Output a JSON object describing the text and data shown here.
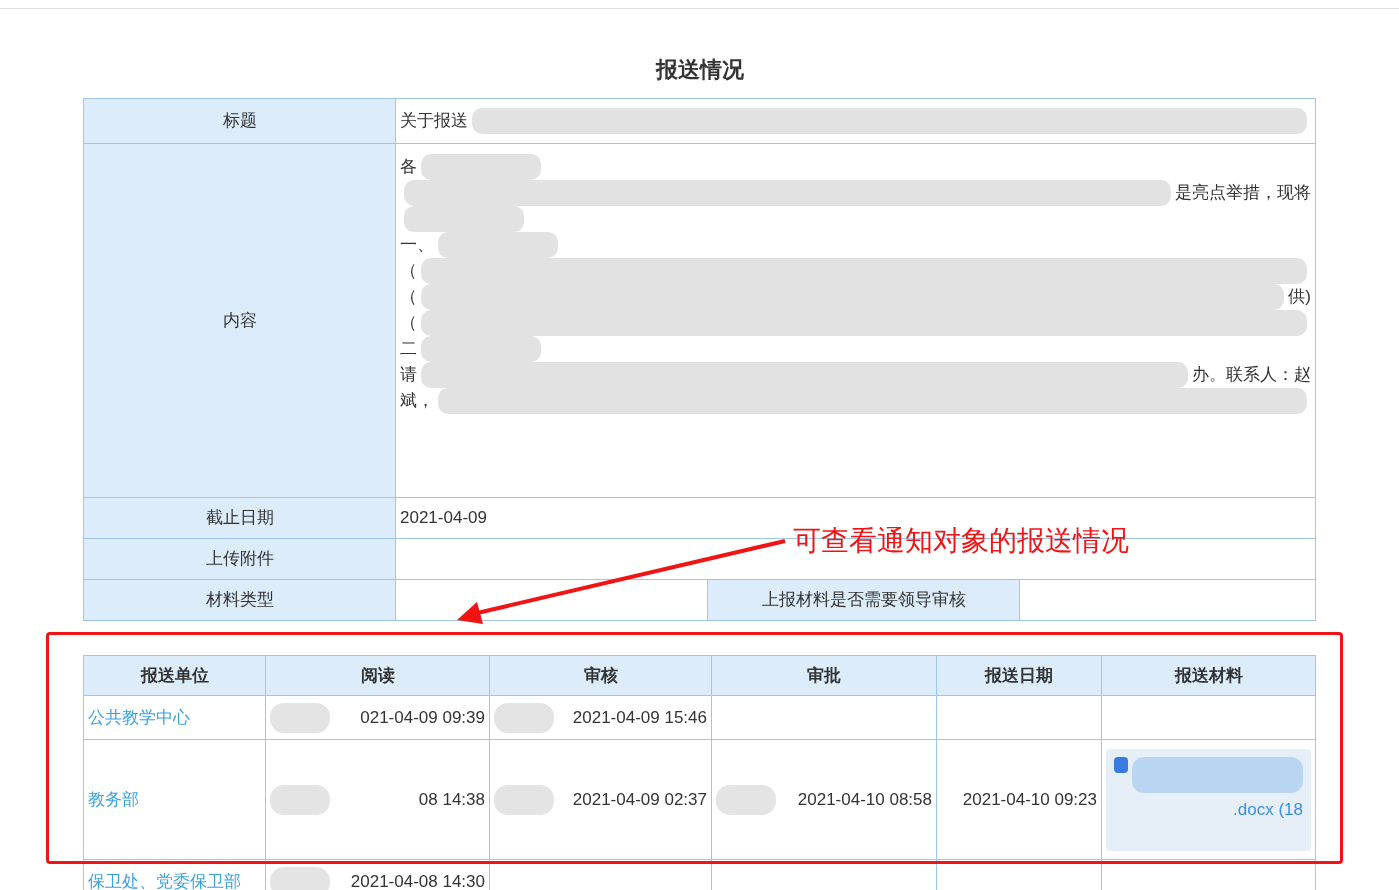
{
  "page_title": "报送情况",
  "info": {
    "rows": [
      {
        "kind": "text",
        "label": "标题",
        "parts": [
          {
            "kind": "text",
            "text": "关于报送"
          },
          {
            "kind": "redacted"
          }
        ]
      },
      {
        "kind": "content",
        "label": "内容",
        "lines": [
          {
            "parts": [
              {
                "kind": "text",
                "text": "各"
              },
              {
                "kind": "redacted-short"
              }
            ]
          },
          {
            "parts": [
              {
                "kind": "redacted"
              },
              {
                "kind": "text",
                "text": "是亮点举措，现将"
              }
            ]
          },
          {
            "parts": [
              {
                "kind": "redacted-short"
              }
            ]
          },
          {
            "parts": [
              {
                "kind": "text",
                "text": "一、"
              },
              {
                "kind": "redacted-short"
              }
            ]
          },
          {
            "parts": [
              {
                "kind": "text",
                "text": "（"
              },
              {
                "kind": "redacted"
              }
            ]
          },
          {
            "parts": [
              {
                "kind": "text",
                "text": "（"
              },
              {
                "kind": "redacted"
              },
              {
                "kind": "text",
                "text": "供)"
              }
            ]
          },
          {
            "parts": [
              {
                "kind": "text",
                "text": "（"
              },
              {
                "kind": "redacted"
              }
            ]
          },
          {
            "parts": [
              {
                "kind": "text",
                "text": "二"
              },
              {
                "kind": "redacted-short"
              }
            ]
          },
          {
            "parts": [
              {
                "kind": "text",
                "text": "请"
              },
              {
                "kind": "redacted"
              },
              {
                "kind": "text",
                "text": "办。联系人：赵"
              }
            ]
          },
          {
            "parts": [
              {
                "kind": "text",
                "text": "斌，"
              },
              {
                "kind": "redacted"
              }
            ]
          }
        ]
      },
      {
        "kind": "text",
        "label": "截止日期",
        "parts": [
          {
            "kind": "text",
            "text": "2021-04-09"
          }
        ]
      },
      {
        "kind": "text",
        "label": "上传附件",
        "parts": []
      },
      {
        "kind": "split",
        "label": "材料类型",
        "second_label": "上报材料是否需要领导审核"
      }
    ]
  },
  "annotation": {
    "text": "可查看通知对象的报送情况"
  },
  "report_table": {
    "columns": [
      "报送单位",
      "阅读",
      "审核",
      "审批",
      "报送日期",
      "报送材料"
    ],
    "rows": [
      {
        "cells": [
          {
            "kind": "link",
            "text": "公共教学中心"
          },
          {
            "kind": "time",
            "redacted": true,
            "text": "021-04-09 09:39"
          },
          {
            "kind": "time",
            "redacted": true,
            "text": "2021-04-09 15:46"
          },
          {
            "kind": "empty"
          },
          {
            "kind": "empty"
          },
          {
            "kind": "empty"
          }
        ]
      },
      {
        "cells": [
          {
            "kind": "link",
            "text": "教务部"
          },
          {
            "kind": "time",
            "redacted": true,
            "text": "08 14:38"
          },
          {
            "kind": "time",
            "redacted": true,
            "text": "2021-04-09 02:37"
          },
          {
            "kind": "time",
            "redacted": true,
            "text": "2021-04-10 08:58"
          },
          {
            "kind": "time",
            "redacted": false,
            "text": "2021-04-10 09:23"
          },
          {
            "kind": "file",
            "text": ".docx (18"
          }
        ]
      },
      {
        "cells": [
          {
            "kind": "link",
            "text": "保卫处、党委保卫部"
          },
          {
            "kind": "time",
            "redacted": true,
            "text": "2021-04-08 14:30"
          },
          {
            "kind": "empty"
          },
          {
            "kind": "empty"
          },
          {
            "kind": "empty"
          },
          {
            "kind": "empty"
          }
        ]
      }
    ]
  }
}
